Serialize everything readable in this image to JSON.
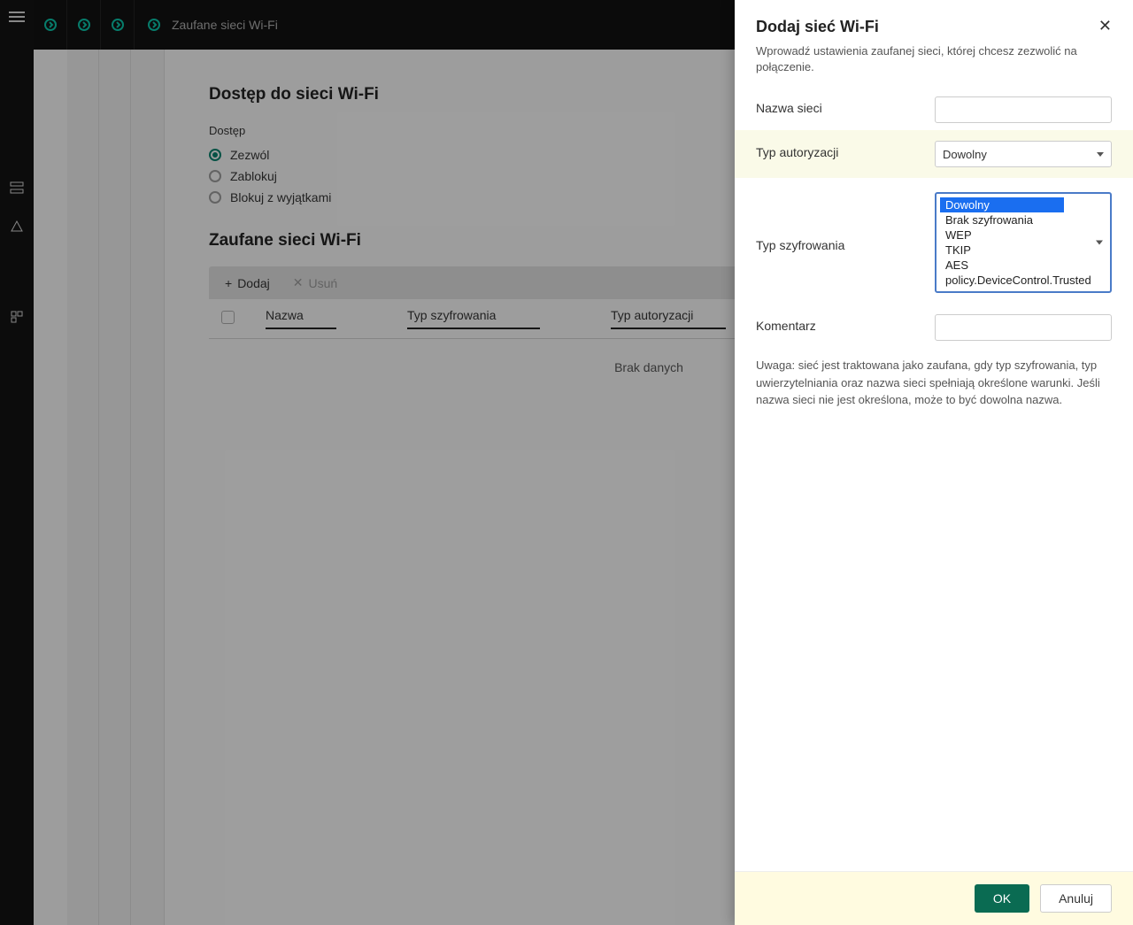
{
  "topbar": {
    "breadcrumb_title": "Zaufane sieci Wi-Fi"
  },
  "content": {
    "heading": "Dostęp do sieci Wi-Fi",
    "access_label": "Dostęp",
    "radios": {
      "allow": "Zezwól",
      "block": "Zablokuj",
      "block_exc": "Blokuj z wyjątkami"
    },
    "trusted_heading": "Zaufane sieci Wi-Fi",
    "toolbar": {
      "add": "Dodaj",
      "delete": "Usuń"
    },
    "columns": {
      "name": "Nazwa",
      "enc": "Typ szyfrowania",
      "auth": "Typ autoryzacji"
    },
    "nodata": "Brak danych"
  },
  "panel": {
    "title": "Dodaj sieć Wi-Fi",
    "desc": "Wprowadź ustawienia zaufanej sieci, której chcesz zezwolić na połączenie.",
    "labels": {
      "name": "Nazwa sieci",
      "auth": "Typ autoryzacji",
      "enc": "Typ szyfrowania",
      "comment": "Komentarz"
    },
    "auth_selected": "Dowolny",
    "enc_options": [
      "Dowolny",
      "Brak szyfrowania",
      "WEP",
      "TKIP",
      "AES",
      "policy.DeviceControl.Trusted"
    ],
    "note": "Uwaga: sieć jest traktowana jako zaufana, gdy typ szyfrowania, typ uwierzytelniania oraz nazwa sieci spełniają określone warunki. Jeśli nazwa sieci nie jest określona, może to być dowolna nazwa.",
    "buttons": {
      "ok": "OK",
      "cancel": "Anuluj"
    }
  }
}
